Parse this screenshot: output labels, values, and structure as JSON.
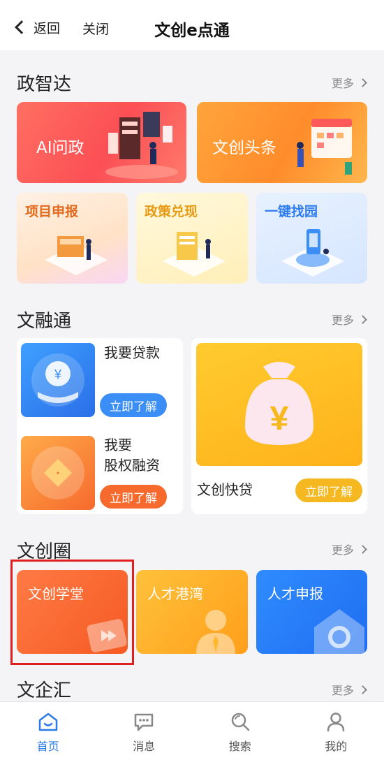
{
  "header": {
    "back_label": "返回",
    "close_label": "关闭",
    "title": "文创e点通"
  },
  "more_label": "更多",
  "sections": {
    "zhengzhida": {
      "title": "政智达",
      "cards": {
        "ai": "AI问政",
        "news": "文创头条",
        "project": "项目申报",
        "policy": "政策兑现",
        "park": "一键找园"
      }
    },
    "wenrongtong": {
      "title": "文融通",
      "loan_text": "我要贷款",
      "equity_line1": "我要",
      "equity_line2": "股权融资",
      "quick_loan_text": "文创快贷",
      "cta_label": "立即了解"
    },
    "wenchuangquan": {
      "title": "文创圈",
      "cards": {
        "school": "文创学堂",
        "talent_bay": "人才港湾",
        "talent_apply": "人才申报"
      }
    },
    "wenqihui": {
      "title": "文企汇"
    }
  },
  "bottom_nav": [
    {
      "label": "首页",
      "icon": "home-icon",
      "active": true
    },
    {
      "label": "消息",
      "icon": "message-icon",
      "active": false
    },
    {
      "label": "搜索",
      "icon": "search-icon",
      "active": false
    },
    {
      "label": "我的",
      "icon": "profile-icon",
      "active": false
    }
  ],
  "colors": {
    "accent": "#2a7ae8",
    "highlight_box": "#e02020"
  }
}
